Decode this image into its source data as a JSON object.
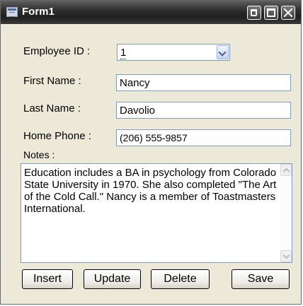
{
  "window": {
    "title": "Form1"
  },
  "form": {
    "employee_id_label": "Employee ID :",
    "employee_id_value": "1",
    "first_name_label": "First Name :",
    "first_name_value": "Nancy",
    "last_name_label": "Last Name :",
    "last_name_value": "Davolio",
    "home_phone_label": "Home Phone :",
    "home_phone_value": "(206) 555-9857",
    "notes_label": "Notes :",
    "notes_value": "Education includes a BA in psychology from Colorado State University in 1970.  She also completed \"The Art of the Cold Call.\"  Nancy is a member of Toastmasters International."
  },
  "buttons": {
    "insert": "Insert",
    "update": "Update",
    "delete": "Delete",
    "save": "Save"
  },
  "icons": {
    "app": "form-icon",
    "minimize": "minimize-icon",
    "maximize": "maximize-icon",
    "close": "close-icon",
    "dropdown": "chevron-down-icon",
    "scroll_up": "scroll-up-icon",
    "scroll_down": "scroll-down-icon"
  }
}
